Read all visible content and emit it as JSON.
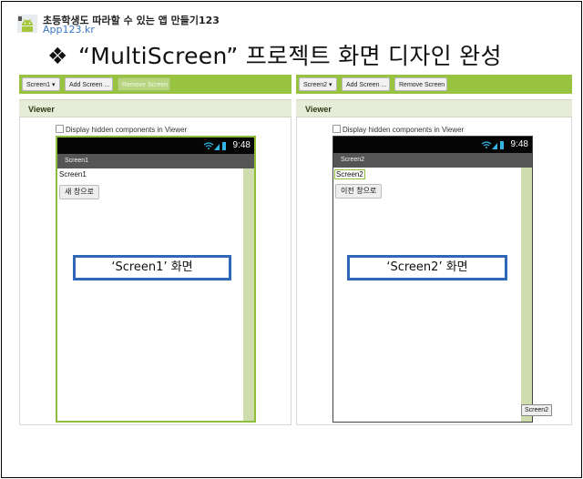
{
  "header": {
    "title": "초등학생도 따라할 수 있는 앱 만들기123",
    "subtitle": "App123.kr"
  },
  "slide": {
    "bullet": "❖",
    "title": "“MultiScreen” 프로젝트 화면 디자인 완성"
  },
  "colors": {
    "toolbar_green": "#97c340",
    "callout_blue": "#2f68b9",
    "selection_green": "#8fbf3a"
  },
  "panels": [
    {
      "toolbar": {
        "screen_select": "Screen1 ▾",
        "add_screen": "Add Screen ...",
        "remove_screen": "Remove Screen"
      },
      "viewer_title": "Viewer",
      "hidden_components_label": "Display hidden components in Viewer",
      "phone": {
        "time": "9:48",
        "title_bar": "Screen1",
        "label": "Screen1",
        "button": "새 창으로"
      },
      "callout": "‘Screen1’ 화면"
    },
    {
      "toolbar": {
        "screen_select": "Screen2 ▾",
        "add_screen": "Add Screen ...",
        "remove_screen": "Remove Screen"
      },
      "viewer_title": "Viewer",
      "hidden_components_label": "Display hidden components in Viewer",
      "phone": {
        "time": "9:48",
        "title_bar": "Screen2",
        "label": "Screen2",
        "button": "이전 창으로"
      },
      "callout": "‘Screen2’ 화면",
      "tooltip": "Screen2"
    }
  ]
}
